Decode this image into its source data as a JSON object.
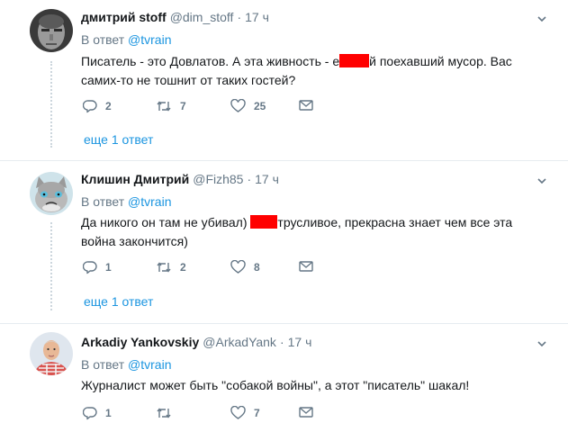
{
  "tweets": [
    {
      "name": "дмитрий stoff",
      "handle": "@dim_stoff",
      "dot": "·",
      "time": "17 ч",
      "reply_prefix": "В ответ",
      "reply_to": "@tvrain",
      "line1_a": "Писатель - это Довлатов. А эта живность - е",
      "line1_b": "й поехавший мусор. Вас",
      "line2": "самих-то не тошнит от таких гостей?",
      "replies": "2",
      "retweets": "7",
      "likes": "25",
      "more": "еще 1 ответ"
    },
    {
      "name": "Клишин Дмитрий",
      "handle": "@Fizh85",
      "dot": "·",
      "time": "17 ч",
      "reply_prefix": "В ответ",
      "reply_to": "@tvrain",
      "line1_a": "Да никого он там не убивал) ",
      "line1_b": "трусливое, прекрасна знает чем все эта",
      "line2": "война закончится)",
      "replies": "1",
      "retweets": "2",
      "likes": "8",
      "more": "еще 1 ответ"
    },
    {
      "name": "Arkadiy Yankovskiy",
      "handle": "@ArkadYank",
      "dot": "·",
      "time": "17 ч",
      "reply_prefix": "В ответ",
      "reply_to": "@tvrain",
      "line1": "Журналист может быть \"собакой войны\", а этот \"писатель\" шакал!",
      "replies": "1",
      "retweets": "",
      "likes": "7"
    }
  ],
  "colors": {
    "link": "#1b95e0",
    "muted": "#657786",
    "redaction": "#ff0000"
  }
}
